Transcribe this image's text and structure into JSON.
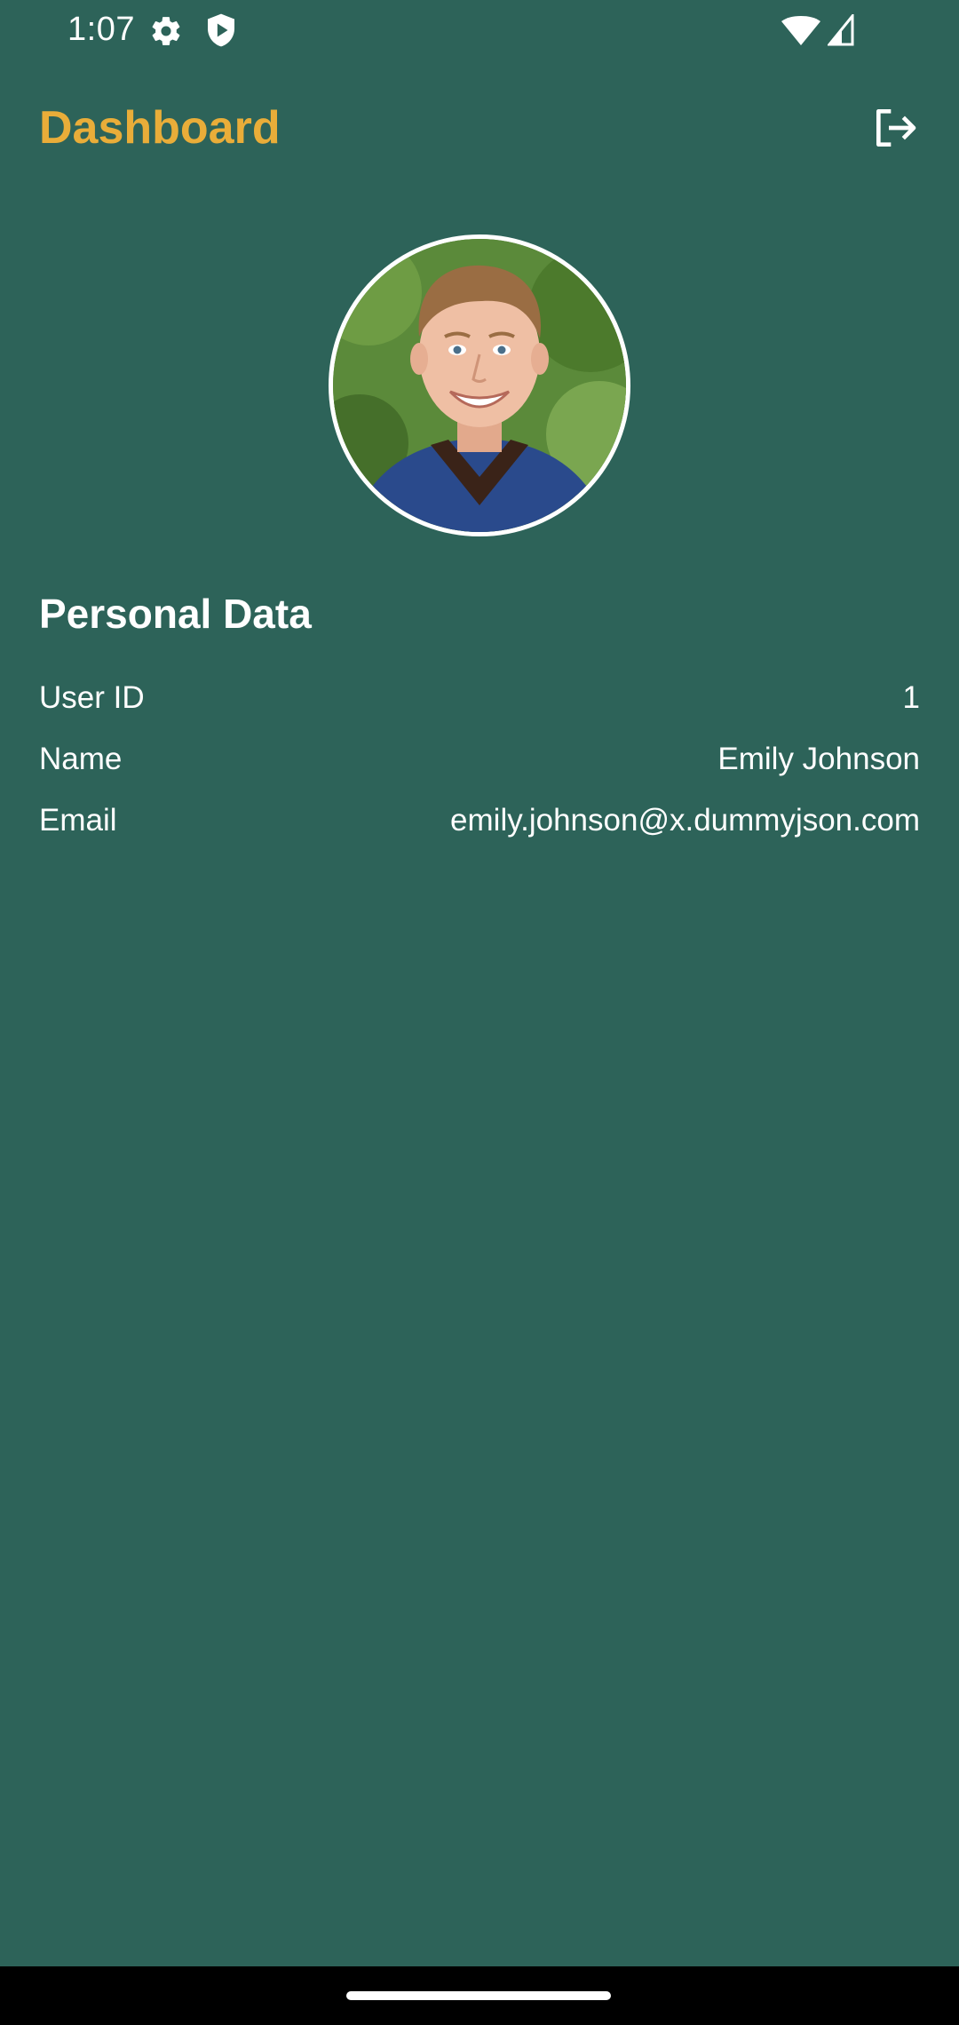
{
  "status_bar": {
    "time": "1:07",
    "icons": [
      "settings-gear-icon",
      "play-protect-shield-icon",
      "wifi-icon",
      "cell-signal-icon"
    ]
  },
  "app_bar": {
    "title": "Dashboard",
    "title_color": "#e9ad39",
    "actions": [
      "logout-icon"
    ]
  },
  "profile": {
    "avatar": "user-avatar-photo"
  },
  "personal_data": {
    "heading": "Personal Data",
    "rows": [
      {
        "label": "User ID",
        "value": "1"
      },
      {
        "label": "Name",
        "value": "Emily Johnson"
      },
      {
        "label": "Email",
        "value": "emily.johnson@x.dummyjson.com"
      }
    ]
  },
  "colors": {
    "background": "#2d6359",
    "accent": "#e9ad39",
    "text": "#ffffff",
    "nav_bar": "#000000"
  }
}
